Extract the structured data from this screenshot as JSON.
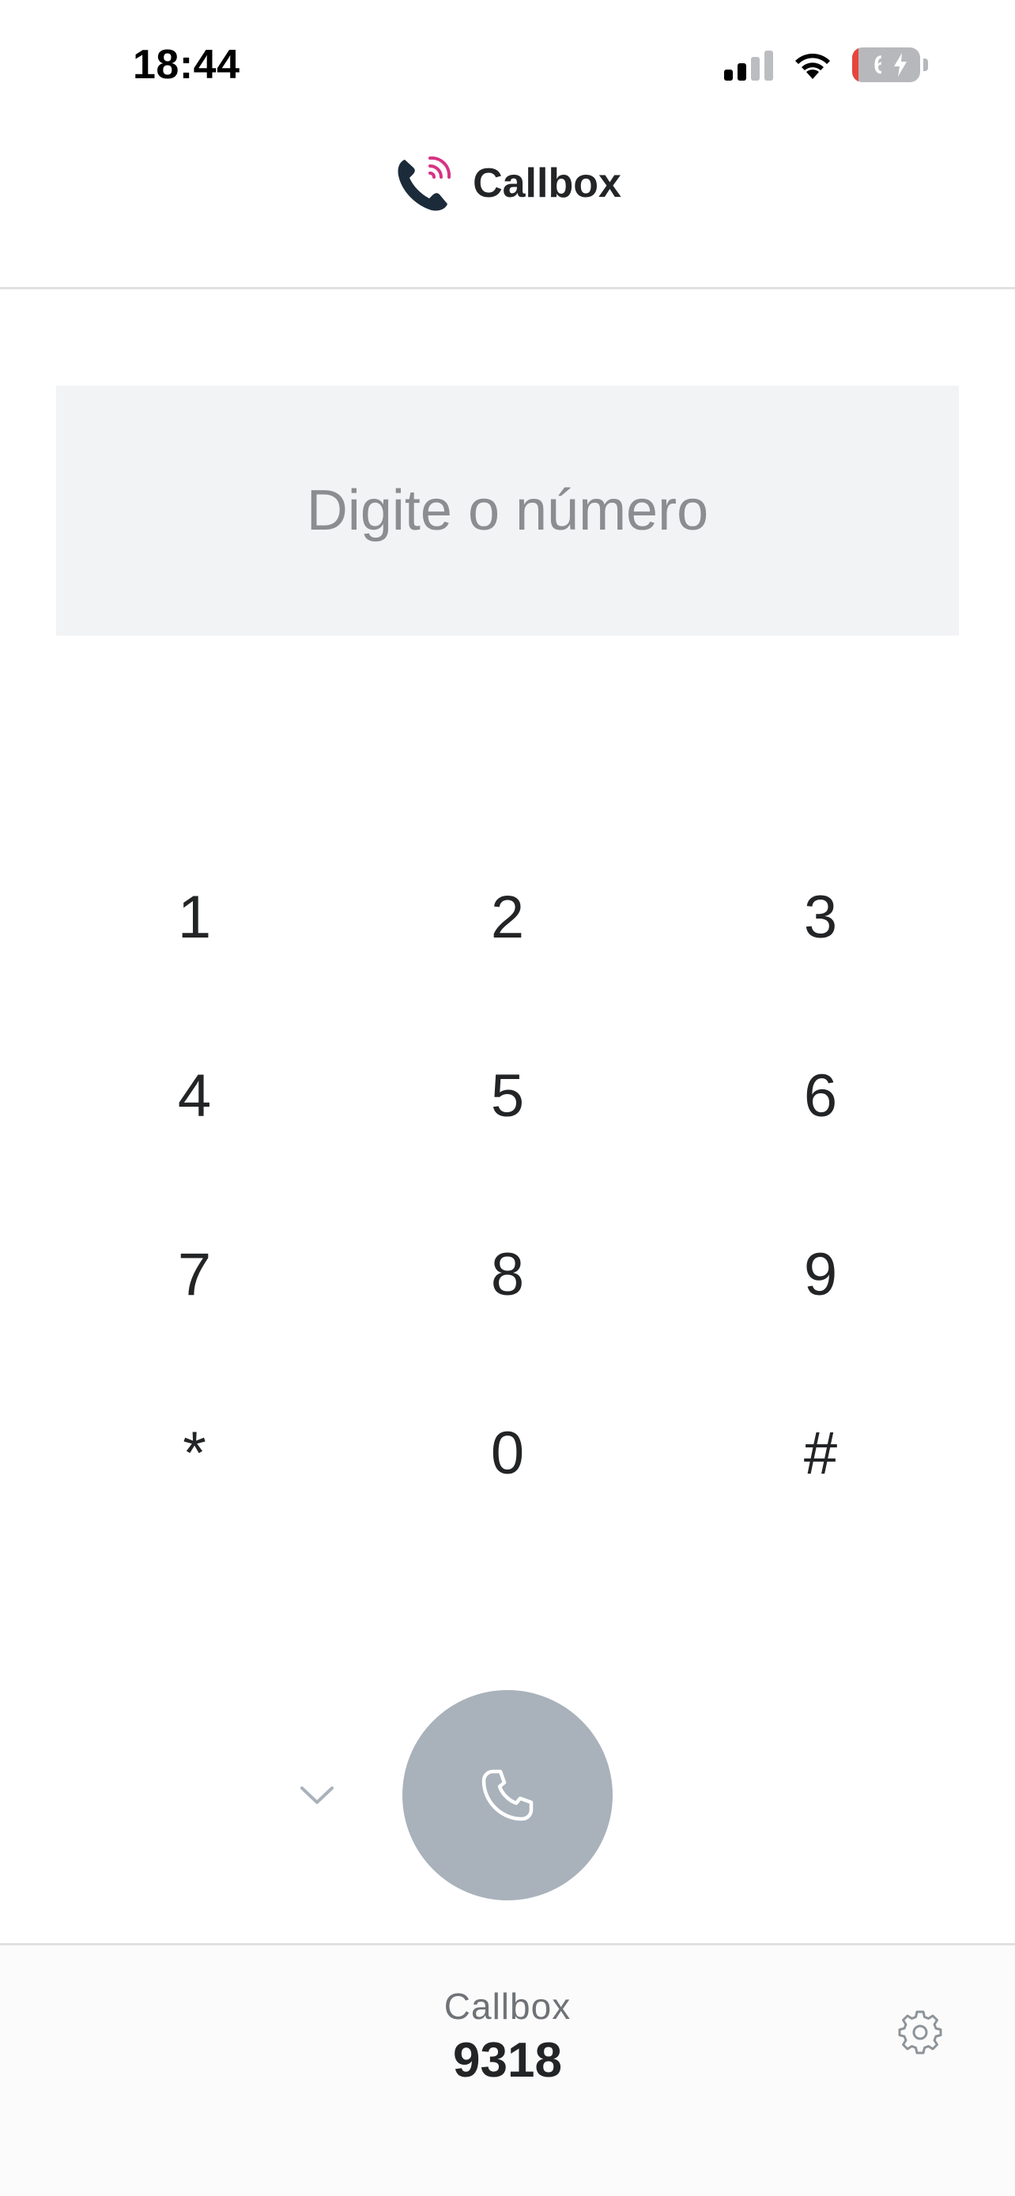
{
  "status_bar": {
    "time": "18:44",
    "battery_level": "64",
    "battery_charging": true,
    "signal_bars_active": 2,
    "signal_bars_total": 4
  },
  "header": {
    "app_title": "Callbox",
    "logo_icon": "phone-ringing-icon",
    "accent_color": "#d63384"
  },
  "dialer": {
    "number_placeholder": "Digite o número",
    "number_value": "",
    "keys": [
      "1",
      "2",
      "3",
      "4",
      "5",
      "6",
      "7",
      "8",
      "9",
      "*",
      "0",
      "#"
    ],
    "collapse_icon": "chevron-down-icon",
    "call_icon": "phone-icon",
    "call_button_color": "#a9b2bb"
  },
  "footer": {
    "label": "Callbox",
    "extension": "9318",
    "settings_icon": "gear-icon"
  }
}
